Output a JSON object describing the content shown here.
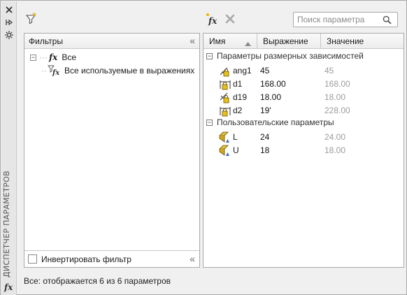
{
  "palette": {
    "title": "ДИСПЕТЧЕР ПАРАМЕТРОВ",
    "fx_symbol": "fx",
    "buttons": [
      "close-icon",
      "pin-icon",
      "settings-icon"
    ]
  },
  "toolbar": {
    "filter_icon": "funnel-icon",
    "new_param_icon": "new-user-parameter-icon",
    "delete_icon": "delete-icon",
    "search_placeholder": "Поиск параметра",
    "search_value": ""
  },
  "filters": {
    "header": "Фильтры",
    "collapse": "«",
    "tree": [
      {
        "expander": "−",
        "label": "Все",
        "icon": "fx-icon"
      },
      {
        "label": "Все используемые в выражениях",
        "icon": "filter-fx-icon"
      }
    ],
    "invert_label": "Инвертировать фильтр",
    "invert_checked": false,
    "footer_collapse": "«"
  },
  "grid": {
    "columns": [
      "Имя",
      "Выражение",
      "Значение"
    ],
    "sort": "ascending",
    "groups": [
      {
        "expander": "⊟",
        "title": "Параметры размерных зависимостей",
        "rows": [
          {
            "name": "ang1",
            "expression": "45",
            "value": "45",
            "icon": "angular-constraint-icon"
          },
          {
            "name": "d1",
            "expression": "168.00",
            "value": "168.00",
            "icon": "linear-constraint-icon"
          },
          {
            "name": "d19",
            "expression": "18.00",
            "value": "18.00",
            "icon": "aligned-constraint-icon"
          },
          {
            "name": "d2",
            "expression": "19'",
            "value": "228.00",
            "icon": "linear-constraint-icon"
          }
        ]
      },
      {
        "expander": "⊟",
        "title": "Пользовательские параметры",
        "rows": [
          {
            "name": "L",
            "expression": "24",
            "value": "24.00",
            "icon": "user-parameter-icon"
          },
          {
            "name": "U",
            "expression": "18",
            "value": "18.00",
            "icon": "user-parameter-icon"
          }
        ]
      }
    ]
  },
  "status_text": "Все: отображается 6 из 6 параметров",
  "colors": {
    "lock_yellow": "#e8c020",
    "user_param_yellow": "#e0c040",
    "dim_blue": "#3a6bc8",
    "value_gray": "#9b9b9b"
  }
}
